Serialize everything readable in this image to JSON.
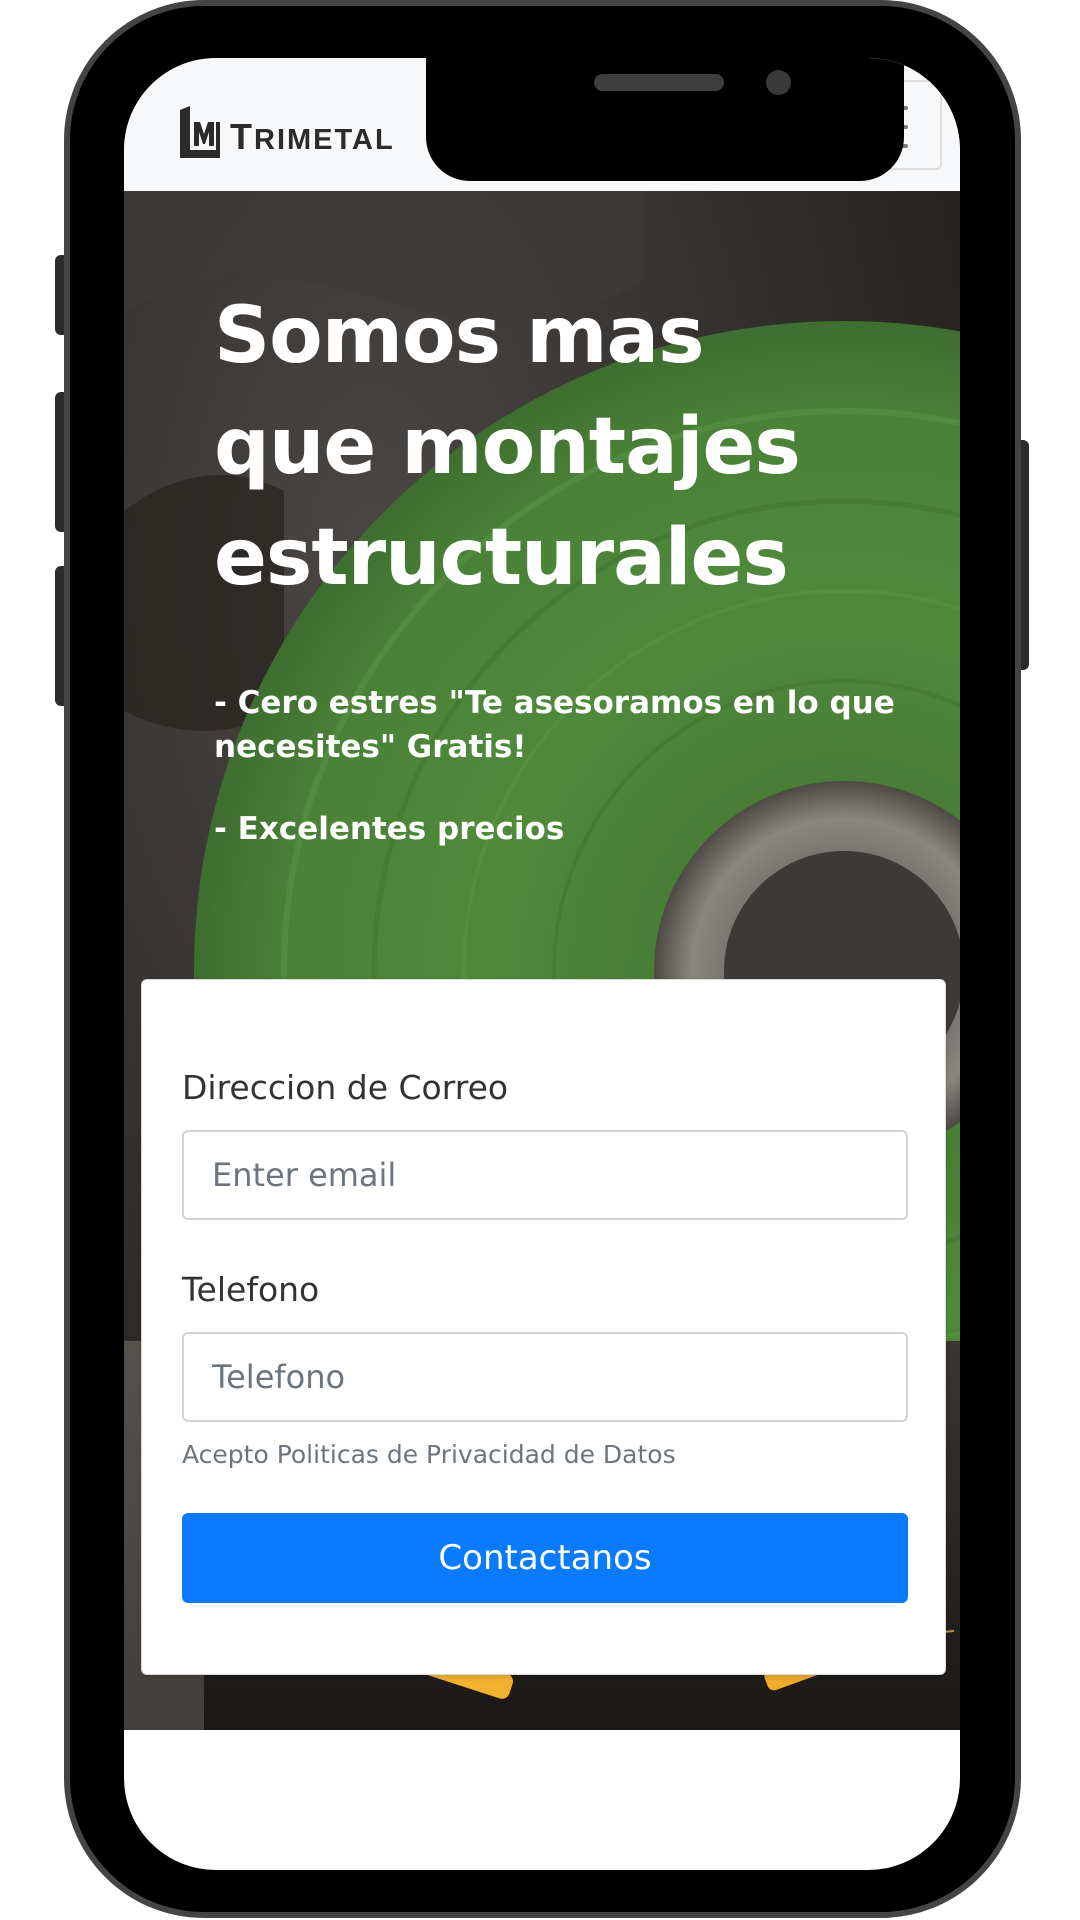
{
  "navbar": {
    "brand_name": "TRIMETAL",
    "brand_first_letter": "T",
    "brand_rest": "RIMETAL",
    "menu_icon": "hamburger-menu-icon"
  },
  "hero": {
    "title_line1": "Somos mas",
    "title_line2": "que montajes",
    "title_line3": "estructurales",
    "point1": "- Cero estres \"Te asesoramos en lo que necesites\" Gratis!",
    "point2": "- Excelentes precios"
  },
  "form": {
    "email_label": "Direccion de Correo",
    "email_placeholder": "Enter email",
    "phone_label": "Telefono",
    "phone_placeholder": "Telefono",
    "privacy_text": "Acepto Politicas de Privacidad de Datos",
    "submit_label": "Contactanos"
  },
  "colors": {
    "primary_button": "#0a7bff",
    "navbar_bg": "#f7f8fa",
    "phone_frame": "#000000",
    "phone_bezel": "#444444",
    "grinder_disc": "#4f8a3b"
  }
}
